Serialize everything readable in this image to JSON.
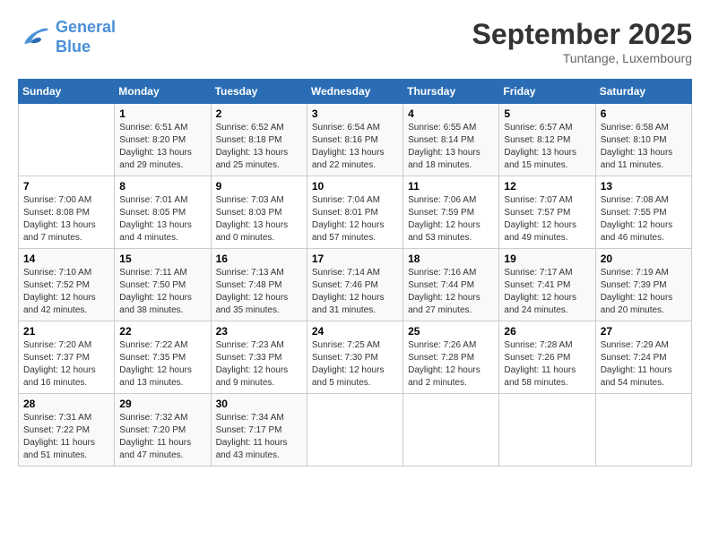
{
  "header": {
    "logo_line1": "General",
    "logo_line2": "Blue",
    "month": "September 2025",
    "location": "Tuntange, Luxembourg"
  },
  "weekdays": [
    "Sunday",
    "Monday",
    "Tuesday",
    "Wednesday",
    "Thursday",
    "Friday",
    "Saturday"
  ],
  "weeks": [
    [
      {
        "day": "",
        "info": ""
      },
      {
        "day": "1",
        "info": "Sunrise: 6:51 AM\nSunset: 8:20 PM\nDaylight: 13 hours\nand 29 minutes."
      },
      {
        "day": "2",
        "info": "Sunrise: 6:52 AM\nSunset: 8:18 PM\nDaylight: 13 hours\nand 25 minutes."
      },
      {
        "day": "3",
        "info": "Sunrise: 6:54 AM\nSunset: 8:16 PM\nDaylight: 13 hours\nand 22 minutes."
      },
      {
        "day": "4",
        "info": "Sunrise: 6:55 AM\nSunset: 8:14 PM\nDaylight: 13 hours\nand 18 minutes."
      },
      {
        "day": "5",
        "info": "Sunrise: 6:57 AM\nSunset: 8:12 PM\nDaylight: 13 hours\nand 15 minutes."
      },
      {
        "day": "6",
        "info": "Sunrise: 6:58 AM\nSunset: 8:10 PM\nDaylight: 13 hours\nand 11 minutes."
      }
    ],
    [
      {
        "day": "7",
        "info": "Sunrise: 7:00 AM\nSunset: 8:08 PM\nDaylight: 13 hours\nand 7 minutes."
      },
      {
        "day": "8",
        "info": "Sunrise: 7:01 AM\nSunset: 8:05 PM\nDaylight: 13 hours\nand 4 minutes."
      },
      {
        "day": "9",
        "info": "Sunrise: 7:03 AM\nSunset: 8:03 PM\nDaylight: 13 hours\nand 0 minutes."
      },
      {
        "day": "10",
        "info": "Sunrise: 7:04 AM\nSunset: 8:01 PM\nDaylight: 12 hours\nand 57 minutes."
      },
      {
        "day": "11",
        "info": "Sunrise: 7:06 AM\nSunset: 7:59 PM\nDaylight: 12 hours\nand 53 minutes."
      },
      {
        "day": "12",
        "info": "Sunrise: 7:07 AM\nSunset: 7:57 PM\nDaylight: 12 hours\nand 49 minutes."
      },
      {
        "day": "13",
        "info": "Sunrise: 7:08 AM\nSunset: 7:55 PM\nDaylight: 12 hours\nand 46 minutes."
      }
    ],
    [
      {
        "day": "14",
        "info": "Sunrise: 7:10 AM\nSunset: 7:52 PM\nDaylight: 12 hours\nand 42 minutes."
      },
      {
        "day": "15",
        "info": "Sunrise: 7:11 AM\nSunset: 7:50 PM\nDaylight: 12 hours\nand 38 minutes."
      },
      {
        "day": "16",
        "info": "Sunrise: 7:13 AM\nSunset: 7:48 PM\nDaylight: 12 hours\nand 35 minutes."
      },
      {
        "day": "17",
        "info": "Sunrise: 7:14 AM\nSunset: 7:46 PM\nDaylight: 12 hours\nand 31 minutes."
      },
      {
        "day": "18",
        "info": "Sunrise: 7:16 AM\nSunset: 7:44 PM\nDaylight: 12 hours\nand 27 minutes."
      },
      {
        "day": "19",
        "info": "Sunrise: 7:17 AM\nSunset: 7:41 PM\nDaylight: 12 hours\nand 24 minutes."
      },
      {
        "day": "20",
        "info": "Sunrise: 7:19 AM\nSunset: 7:39 PM\nDaylight: 12 hours\nand 20 minutes."
      }
    ],
    [
      {
        "day": "21",
        "info": "Sunrise: 7:20 AM\nSunset: 7:37 PM\nDaylight: 12 hours\nand 16 minutes."
      },
      {
        "day": "22",
        "info": "Sunrise: 7:22 AM\nSunset: 7:35 PM\nDaylight: 12 hours\nand 13 minutes."
      },
      {
        "day": "23",
        "info": "Sunrise: 7:23 AM\nSunset: 7:33 PM\nDaylight: 12 hours\nand 9 minutes."
      },
      {
        "day": "24",
        "info": "Sunrise: 7:25 AM\nSunset: 7:30 PM\nDaylight: 12 hours\nand 5 minutes."
      },
      {
        "day": "25",
        "info": "Sunrise: 7:26 AM\nSunset: 7:28 PM\nDaylight: 12 hours\nand 2 minutes."
      },
      {
        "day": "26",
        "info": "Sunrise: 7:28 AM\nSunset: 7:26 PM\nDaylight: 11 hours\nand 58 minutes."
      },
      {
        "day": "27",
        "info": "Sunrise: 7:29 AM\nSunset: 7:24 PM\nDaylight: 11 hours\nand 54 minutes."
      }
    ],
    [
      {
        "day": "28",
        "info": "Sunrise: 7:31 AM\nSunset: 7:22 PM\nDaylight: 11 hours\nand 51 minutes."
      },
      {
        "day": "29",
        "info": "Sunrise: 7:32 AM\nSunset: 7:20 PM\nDaylight: 11 hours\nand 47 minutes."
      },
      {
        "day": "30",
        "info": "Sunrise: 7:34 AM\nSunset: 7:17 PM\nDaylight: 11 hours\nand 43 minutes."
      },
      {
        "day": "",
        "info": ""
      },
      {
        "day": "",
        "info": ""
      },
      {
        "day": "",
        "info": ""
      },
      {
        "day": "",
        "info": ""
      }
    ]
  ]
}
